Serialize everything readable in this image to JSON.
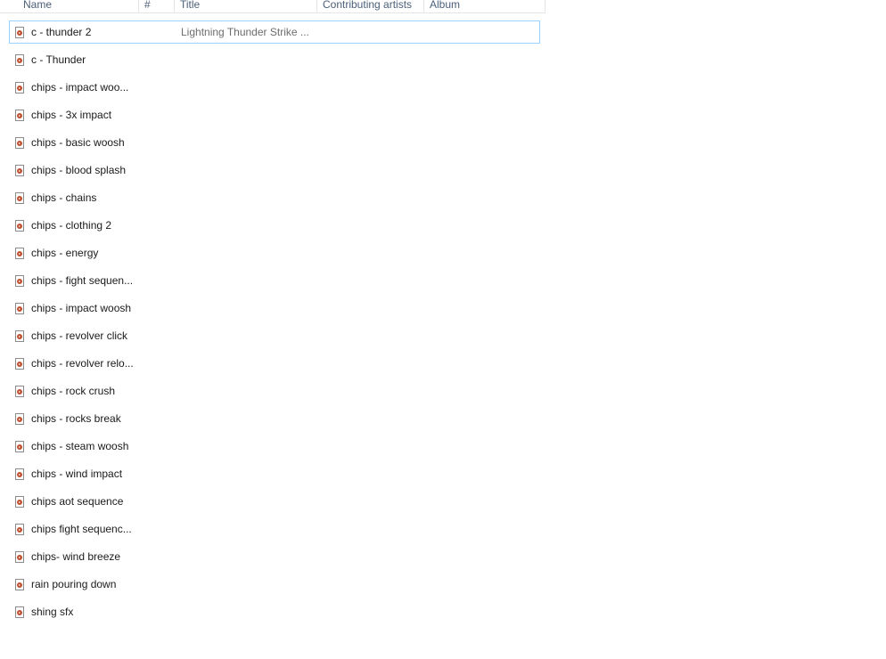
{
  "columns": {
    "name": "Name",
    "number": "#",
    "title": "Title",
    "contributing_artists": "Contributing artists",
    "album": "Album"
  },
  "files": [
    {
      "name": "c - thunder 2",
      "title": "Lightning Thunder Strike ...",
      "selected": true
    },
    {
      "name": "c - Thunder",
      "title": ""
    },
    {
      "name": "chips  - impact woo...",
      "title": ""
    },
    {
      "name": "chips - 3x impact",
      "title": ""
    },
    {
      "name": "chips - basic woosh",
      "title": ""
    },
    {
      "name": "chips - blood splash",
      "title": ""
    },
    {
      "name": "chips - chains",
      "title": ""
    },
    {
      "name": "chips - clothing 2",
      "title": ""
    },
    {
      "name": "chips - energy",
      "title": ""
    },
    {
      "name": "chips - fight sequen...",
      "title": ""
    },
    {
      "name": "chips - impact woosh",
      "title": ""
    },
    {
      "name": "chips - revolver click",
      "title": ""
    },
    {
      "name": "chips - revolver relo...",
      "title": ""
    },
    {
      "name": "chips - rock crush",
      "title": ""
    },
    {
      "name": "chips - rocks break",
      "title": ""
    },
    {
      "name": "chips - steam woosh",
      "title": ""
    },
    {
      "name": "chips - wind impact",
      "title": ""
    },
    {
      "name": "chips aot sequence",
      "title": ""
    },
    {
      "name": "chips fight sequenc...",
      "title": ""
    },
    {
      "name": "chips- wind breeze",
      "title": ""
    },
    {
      "name": "rain pouring down",
      "title": ""
    },
    {
      "name": "shing sfx",
      "title": ""
    }
  ]
}
